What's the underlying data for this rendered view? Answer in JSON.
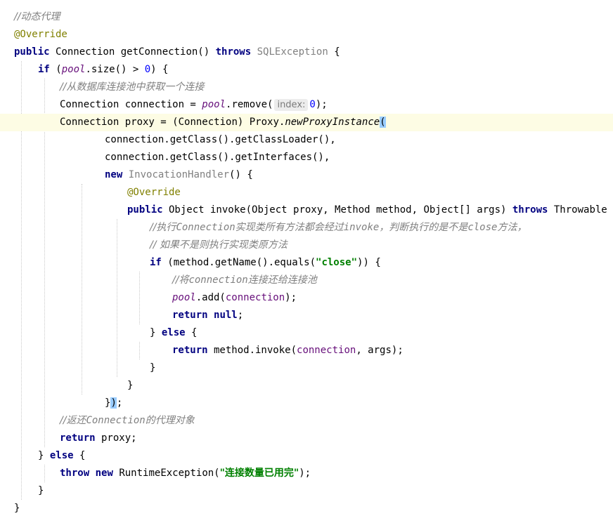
{
  "editor": {
    "lines": [
      {
        "indent": 0,
        "guides": 0,
        "tokens": [
          {
            "t": "//动态代理",
            "c": "cmt cn"
          }
        ]
      },
      {
        "indent": 0,
        "guides": 0,
        "tokens": [
          {
            "t": "@Override",
            "c": "ann"
          }
        ]
      },
      {
        "indent": 0,
        "guides": 0,
        "tokens": [
          {
            "t": "public",
            "c": "kw"
          },
          {
            "t": " Connection getConnection() ",
            "c": ""
          },
          {
            "t": "throws",
            "c": "kw"
          },
          {
            "t": " ",
            "c": ""
          },
          {
            "t": "SQLException",
            "c": "gray"
          },
          {
            "t": " {",
            "c": ""
          }
        ]
      },
      {
        "indent": 1,
        "guides": 1,
        "tokens": [
          {
            "t": "if",
            "c": "kw"
          },
          {
            "t": " (",
            "c": ""
          },
          {
            "t": "pool",
            "c": "field"
          },
          {
            "t": ".size() > ",
            "c": ""
          },
          {
            "t": "0",
            "c": "num"
          },
          {
            "t": ") {",
            "c": ""
          }
        ]
      },
      {
        "indent": 2,
        "guides": 2,
        "tokens": [
          {
            "t": "//从数据库连接池中获取一个连接",
            "c": "cmt cn"
          }
        ]
      },
      {
        "indent": 2,
        "guides": 2,
        "tokens": [
          {
            "t": "Connection connection = ",
            "c": ""
          },
          {
            "t": "pool",
            "c": "field"
          },
          {
            "t": ".remove(",
            "c": ""
          },
          {
            "t": "index:",
            "c": "hint"
          },
          {
            "t": "0",
            "c": "num"
          },
          {
            "t": ");",
            "c": ""
          }
        ]
      },
      {
        "indent": 2,
        "guides": 2,
        "caret": true,
        "tokens": [
          {
            "t": "Connection ",
            "c": ""
          },
          {
            "t": "proxy",
            "c": ""
          },
          {
            "t": " = (Connection) Proxy.",
            "c": ""
          },
          {
            "t": "newProxyInstance",
            "c": "ital"
          },
          {
            "t": "(",
            "c": "brace-match"
          }
        ]
      },
      {
        "indent": 4,
        "guides": 2,
        "tokens": [
          {
            "t": "connection.getClass().getClassLoader(),",
            "c": ""
          }
        ]
      },
      {
        "indent": 4,
        "guides": 2,
        "tokens": [
          {
            "t": "connection.getClass().getInterfaces(),",
            "c": ""
          }
        ]
      },
      {
        "indent": 4,
        "guides": 2,
        "tokens": [
          {
            "t": "new",
            "c": "kw"
          },
          {
            "t": " ",
            "c": ""
          },
          {
            "t": "InvocationHandler",
            "c": "gray"
          },
          {
            "t": "() {",
            "c": ""
          }
        ]
      },
      {
        "indent": 5,
        "guides": 3,
        "tokens": [
          {
            "t": "@Override",
            "c": "ann"
          }
        ]
      },
      {
        "indent": 5,
        "guides": 3,
        "tokens": [
          {
            "t": "public",
            "c": "kw"
          },
          {
            "t": " Object invoke(Object proxy, Method method, Object[] args) ",
            "c": ""
          },
          {
            "t": "throws",
            "c": "kw"
          },
          {
            "t": " Throwable {",
            "c": ""
          }
        ]
      },
      {
        "indent": 6,
        "guides": 4,
        "tokens": [
          {
            "t": "//执行",
            "c": "cmt cn"
          },
          {
            "t": "Connection",
            "c": "cmt"
          },
          {
            "t": "实现类所有方法都会经过",
            "c": "cmt cn"
          },
          {
            "t": "invoke",
            "c": "cmt"
          },
          {
            "t": "，判断执行的是不是",
            "c": "cmt cn"
          },
          {
            "t": "close",
            "c": "cmt"
          },
          {
            "t": "方法，",
            "c": "cmt cn"
          }
        ]
      },
      {
        "indent": 6,
        "guides": 4,
        "tokens": [
          {
            "t": "// 如果不是则执行实现类原方法",
            "c": "cmt cn"
          }
        ]
      },
      {
        "indent": 6,
        "guides": 4,
        "tokens": [
          {
            "t": "if",
            "c": "kw"
          },
          {
            "t": " (method.getName().equals(",
            "c": ""
          },
          {
            "t": "\"close\"",
            "c": "str"
          },
          {
            "t": ")) {",
            "c": ""
          }
        ]
      },
      {
        "indent": 7,
        "guides": 5,
        "tokens": [
          {
            "t": "//将",
            "c": "cmt cn"
          },
          {
            "t": "connection",
            "c": "cmt"
          },
          {
            "t": "连接还给连接池",
            "c": "cmt cn"
          }
        ]
      },
      {
        "indent": 7,
        "guides": 5,
        "tokens": [
          {
            "t": "pool",
            "c": "field"
          },
          {
            "t": ".add(",
            "c": ""
          },
          {
            "t": "connection",
            "c": "field-plain"
          },
          {
            "t": ");",
            "c": ""
          }
        ]
      },
      {
        "indent": 7,
        "guides": 5,
        "tokens": [
          {
            "t": "return",
            "c": "kw"
          },
          {
            "t": " ",
            "c": ""
          },
          {
            "t": "null",
            "c": "kw"
          },
          {
            "t": ";",
            "c": ""
          }
        ]
      },
      {
        "indent": 6,
        "guides": 4,
        "tokens": [
          {
            "t": "} ",
            "c": ""
          },
          {
            "t": "else",
            "c": "kw"
          },
          {
            "t": " {",
            "c": ""
          }
        ]
      },
      {
        "indent": 7,
        "guides": 5,
        "tokens": [
          {
            "t": "return",
            "c": "kw"
          },
          {
            "t": " method.invoke(",
            "c": ""
          },
          {
            "t": "connection",
            "c": "field-plain"
          },
          {
            "t": ", args);",
            "c": ""
          }
        ]
      },
      {
        "indent": 6,
        "guides": 4,
        "tokens": [
          {
            "t": "}",
            "c": ""
          }
        ]
      },
      {
        "indent": 5,
        "guides": 3,
        "tokens": [
          {
            "t": "}",
            "c": ""
          }
        ]
      },
      {
        "indent": 4,
        "guides": 2,
        "tokens": [
          {
            "t": "}",
            "c": ""
          },
          {
            "t": ")",
            "c": "brace-match"
          },
          {
            "t": ";",
            "c": ""
          }
        ]
      },
      {
        "indent": 2,
        "guides": 2,
        "tokens": [
          {
            "t": "//返还",
            "c": "cmt cn"
          },
          {
            "t": "Connection",
            "c": "cmt"
          },
          {
            "t": "的代理对象",
            "c": "cmt cn"
          }
        ]
      },
      {
        "indent": 2,
        "guides": 2,
        "tokens": [
          {
            "t": "return",
            "c": "kw"
          },
          {
            "t": " proxy;",
            "c": ""
          }
        ]
      },
      {
        "indent": 1,
        "guides": 1,
        "tokens": [
          {
            "t": "} ",
            "c": ""
          },
          {
            "t": "else",
            "c": "kw"
          },
          {
            "t": " {",
            "c": ""
          }
        ]
      },
      {
        "indent": 2,
        "guides": 2,
        "tokens": [
          {
            "t": "throw",
            "c": "kw"
          },
          {
            "t": " ",
            "c": ""
          },
          {
            "t": "new",
            "c": "kw"
          },
          {
            "t": " RuntimeException(",
            "c": ""
          },
          {
            "t": "\"连接数量已用完\"",
            "c": "str cn"
          },
          {
            "t": ");",
            "c": ""
          }
        ]
      },
      {
        "indent": 1,
        "guides": 1,
        "tokens": [
          {
            "t": "}",
            "c": ""
          }
        ]
      },
      {
        "indent": 0,
        "guides": 0,
        "tokens": [
          {
            "t": "}",
            "c": ""
          }
        ]
      }
    ]
  }
}
